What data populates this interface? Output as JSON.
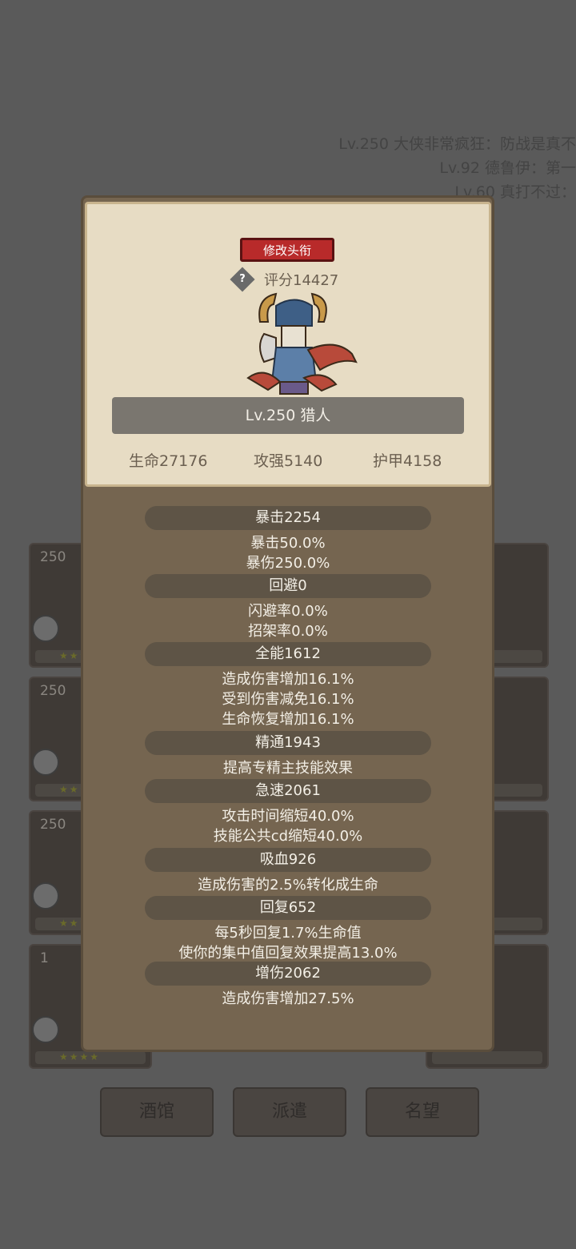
{
  "announcements": [
    "Lv.250 大侠非常疯狂：防战是真不",
    "Lv.92 德鲁伊：第一",
    "Lv.60 真打不过："
  ],
  "cards": [
    {
      "level": "250",
      "stars": "★★★★"
    },
    {
      "level": "250",
      "stars": "★★★★"
    },
    {
      "level": "250",
      "stars": "★★★★"
    },
    {
      "level": "1",
      "stars": "★★★★"
    }
  ],
  "bottom_nav": [
    "酒馆",
    "派遣",
    "名望"
  ],
  "dialog": {
    "rename_button": "修改头衔",
    "help_icon": "?",
    "score": "评分14427",
    "level_class": "Lv.250 猎人",
    "basic_stats": [
      "生命27176",
      "攻强5140",
      "护甲4158"
    ],
    "sections": [
      {
        "title": "暴击2254",
        "lines": [
          "暴击50.0%",
          "暴伤250.0%"
        ]
      },
      {
        "title": "回避0",
        "lines": [
          "闪避率0.0%",
          "招架率0.0%"
        ]
      },
      {
        "title": "全能1612",
        "lines": [
          "造成伤害增加16.1%",
          "受到伤害减免16.1%",
          "生命恢复增加16.1%"
        ]
      },
      {
        "title": "精通1943",
        "lines": [
          "提高专精主技能效果"
        ]
      },
      {
        "title": "急速2061",
        "lines": [
          "攻击时间缩短40.0%",
          "技能公共cd缩短40.0%"
        ]
      },
      {
        "title": "吸血926",
        "lines": [
          "造成伤害的2.5%转化成生命"
        ]
      },
      {
        "title": "回复652",
        "lines": [
          "每5秒回复1.7%生命值",
          "使你的集中值回复效果提高13.0%"
        ]
      },
      {
        "title": "增伤2062",
        "lines": [
          "造成伤害增加27.5%"
        ]
      }
    ]
  }
}
